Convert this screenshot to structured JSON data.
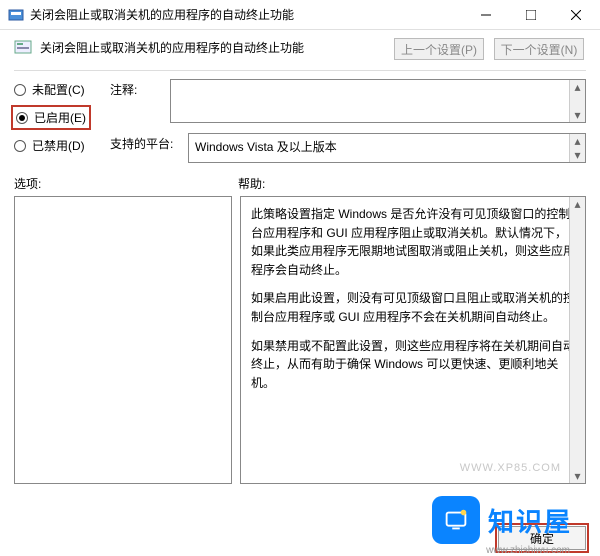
{
  "window": {
    "title": "关闭会阻止或取消关机的应用程序的自动终止功能",
    "header_title": "关闭会阻止或取消关机的应用程序的自动终止功能",
    "prev_setting": "上一个设置(P)",
    "next_setting": "下一个设置(N)"
  },
  "radios": {
    "not_configured": "未配置(C)",
    "enabled": "已启用(E)",
    "disabled": "已禁用(D)"
  },
  "fields": {
    "comment_label": "注释:",
    "platform_label": "支持的平台:",
    "platform_value": "Windows Vista 及以上版本"
  },
  "sections": {
    "options_label": "选项:",
    "help_label": "帮助:"
  },
  "help": {
    "p1": "此策略设置指定 Windows 是否允许没有可见顶级窗口的控制台应用程序和 GUI 应用程序阻止或取消关机。默认情况下，如果此类应用程序无限期地试图取消或阻止关机，则这些应用程序会自动终止。",
    "p2": "如果启用此设置，则没有可见顶级窗口且阻止或取消关机的控制台应用程序或 GUI 应用程序不会在关机期间自动终止。",
    "p3": "如果禁用或不配置此设置，则这些应用程序将在关机期间自动终止，从而有助于确保 Windows 可以更快速、更顺利地关机。",
    "watermark": "WWW.XP85.COM"
  },
  "buttons": {
    "ok": "确定"
  },
  "branding": {
    "text": "知识屋",
    "sub": "www.zhishiwu.com"
  }
}
